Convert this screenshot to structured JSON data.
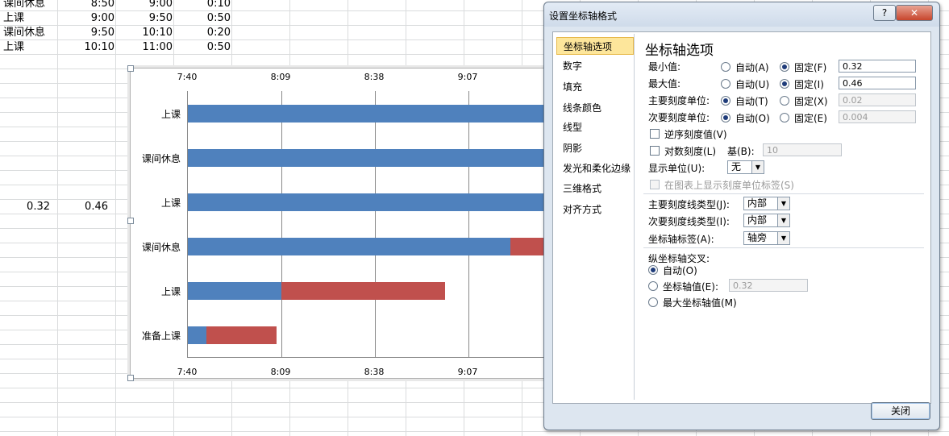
{
  "sheet": {
    "rows": [
      {
        "label": "课间休息",
        "start": "8:50",
        "end": "9:00",
        "dur": "0:10"
      },
      {
        "label": "上课",
        "start": "9:00",
        "end": "9:50",
        "dur": "0:50"
      },
      {
        "label": "课间休息",
        "start": "9:50",
        "end": "10:10",
        "dur": "0:20"
      },
      {
        "label": "上课",
        "start": "10:10",
        "end": "11:00",
        "dur": "0:50"
      }
    ],
    "min_cell": "0.32",
    "max_cell": "0.46"
  },
  "chart_data": {
    "type": "bar",
    "orientation": "horizontal-stacked",
    "top_tick_labels": [
      "7:40",
      "8:09",
      "8:38",
      "9:07"
    ],
    "bottom_tick_labels": [
      "7:40",
      "8:09",
      "8:38",
      "9:07"
    ],
    "xlim": [
      0.32,
      0.46
    ],
    "major_unit": 0.02,
    "categories": [
      "上课",
      "课间休息",
      "上课",
      "课间休息",
      "上课",
      "准备上课"
    ],
    "series": [
      {
        "values": [
          0.416,
          0.406,
          0.399,
          0.389,
          0.34,
          0.324
        ],
        "color": "#4f81bd"
      },
      {
        "values": [
          0.035,
          0.035,
          0.035,
          0.007,
          0.035,
          0.015
        ],
        "color": "#c0504d"
      }
    ]
  },
  "dialog": {
    "title": "设置坐标轴格式",
    "help": "?",
    "close_x": "✕",
    "nav": [
      "坐标轴选项",
      "数字",
      "填充",
      "线条颜色",
      "线型",
      "阴影",
      "发光和柔化边缘",
      "三维格式",
      "对齐方式"
    ],
    "heading": "坐标轴选项",
    "min_label": "最小值:",
    "max_label": "最大值:",
    "major_label": "主要刻度单位:",
    "minor_label": "次要刻度单位:",
    "auto_a": "自动(A)",
    "fixed_f": "固定(F)",
    "auto_u": "自动(U)",
    "fixed_i": "固定(I)",
    "auto_t": "自动(T)",
    "fixed_x": "固定(X)",
    "auto_o": "自动(O)",
    "fixed_e": "固定(E)",
    "min_value": "0.32",
    "max_value": "0.46",
    "major_value": "0.02",
    "minor_value": "0.004",
    "reverse": "逆序刻度值(V)",
    "log": "对数刻度(L)",
    "base_label": "基(B):",
    "base_value": "10",
    "display_units_label": "显示单位(U):",
    "display_units_value": "无",
    "show_units_label": "在图表上显示刻度单位标签(S)",
    "major_tick_label": "主要刻度线类型(J):",
    "major_tick_value": "内部",
    "minor_tick_label": "次要刻度线类型(I):",
    "minor_tick_value": "内部",
    "axis_labels_label": "坐标轴标签(A):",
    "axis_labels_value": "轴旁",
    "cross_heading": "纵坐标轴交叉:",
    "cross_auto": "自动(O)",
    "cross_value_label": "坐标轴值(E):",
    "cross_value": "0.32",
    "cross_max": "最大坐标轴值(M)",
    "close_button": "关闭"
  }
}
